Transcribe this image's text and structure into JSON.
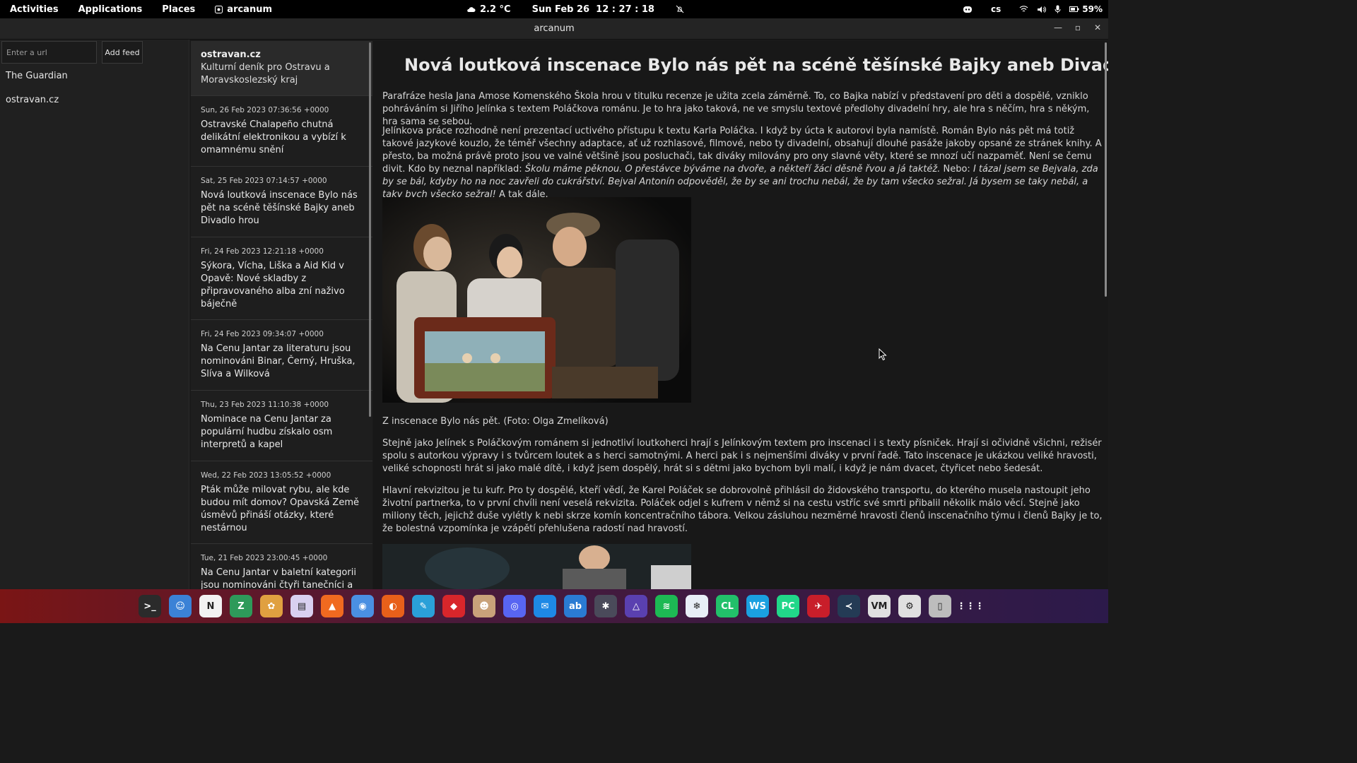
{
  "topbar": {
    "activities": "Activities",
    "applications": "Applications",
    "places": "Places",
    "app_name": "arcanum",
    "weather": "2.2 °C",
    "datetime": "Sun Feb 26  12 : 27 : 18",
    "lang": "cs",
    "battery": "59%"
  },
  "window": {
    "title": "arcanum"
  },
  "feeds": {
    "url_placeholder": "Enter a url",
    "add_label": "Add feed",
    "items": [
      {
        "label": "The Guardian"
      },
      {
        "label": "ostravan.cz"
      }
    ]
  },
  "articles": {
    "site": "ostravan.cz",
    "site_desc": "Kulturní deník pro Ostravu a Moravskoslezský kraj",
    "items": [
      {
        "date": "Sun, 26 Feb 2023 07:36:56 +0000",
        "title": "Ostravské Chalapeño chutná delikátní elektronikou a vybízí k omamnému snění"
      },
      {
        "date": "Sat, 25 Feb 2023 07:14:57 +0000",
        "title": "Nová loutková inscenace Bylo nás pět na scéně těšínské Bajky aneb Divadlo hrou"
      },
      {
        "date": "Fri, 24 Feb 2023 12:21:18 +0000",
        "title": "Sýkora, Vícha, Liška a Aid Kid v Opavě: Nové skladby z připravovaného alba zní naživo báječně"
      },
      {
        "date": "Fri, 24 Feb 2023 09:34:07 +0000",
        "title": "Na Cenu Jantar za literaturu jsou nominováni Binar, Černý, Hruška, Slíva a Wilková"
      },
      {
        "date": "Thu, 23 Feb 2023 11:10:38 +0000",
        "title": "Nominace na Cenu Jantar za populární hudbu získalo osm interpretů a kapel"
      },
      {
        "date": "Wed, 22 Feb 2023 13:05:52 +0000",
        "title": "Pták může milovat rybu, ale kde budou mít domov? Opavská Země úsměvů přináší otázky, které nestárnou"
      },
      {
        "date": "Tue, 21 Feb 2023 23:00:45 +0000",
        "title": "Na Cenu Jantar v baletní kategorii jsou nominováni čtyři tanečníci a"
      }
    ]
  },
  "reader": {
    "title": "Nová loutková inscenace Bylo nás pět na scéně těšínské Bajky aneb Divadlo hrou",
    "p1": "Parafráze hesla Jana Amose Komenského Škola hrou v titulku recenze je užita zcela záměrně. To, co Bajka nabízí v představení pro děti a dospělé, vzniklo pohráváním si Jiřího Jelínka s textem Poláčkova románu. Je to hra jako taková, ne ve smyslu textové předlohy divadelní hry, ale hra s něčím, hra s někým, hra sama se sebou.",
    "p2_a": "Jelínkova práce rozhodně není prezentací uctivého přístupu k textu Karla Poláčka. I když by úcta k autorovi byla namístě. Román Bylo nás pět má totiž takové jazykové kouzlo, že téměř všechny adaptace, ať už rozhlasové, filmové, nebo ty divadelní, obsahují dlouhé pasáže jakoby opsané ze stránek knihy. A přesto, ba možná právě proto jsou ve valné většině jsou posluchači, tak diváky milovány pro ony slavné věty, které se mnozí učí nazpaměť. Není se čemu divit. Kdo by neznal například: ",
    "p2_em1": "Školu máme pěknou. O přestávce býváme na dvoře, a někteří žáci děsně řvou a já taktéž.",
    "p2_b": " Nebo: ",
    "p2_em2": "I tázal jsem se Bejvala, zda by se bál, kdyby ho na noc zavřeli do cukrářství. Bejval Antonín odpověděl, že by se ani trochu nebál, že by tam všecko sežral. Já bysem se taky nebál, a taky bych všecko sežral!",
    "p2_c": " A tak dále.",
    "caption": "Z inscenace Bylo nás pět. (Foto: Olga Zmelíková)",
    "p3": "Stejně jako Jelínek s Poláčkovým románem si jednotliví loutkoherci hrají s Jelínkovým textem pro inscenaci i s texty písniček. Hrají si očividně všichni, režisér spolu s autorkou výpravy i s tvůrcem loutek a s herci samotnými. A herci pak i s nejmenšími diváky v první řadě. Tato inscenace je ukázkou veliké hravosti, veliké schopnosti hrát si jako malé dítě, i když jsem dospělý, hrát si s dětmi jako bychom byli malí, i když je nám dvacet, čtyřicet nebo šedesát.",
    "p4": "Hlavní rekvizitou je tu kufr. Pro ty dospělé, kteří vědí, že Karel Poláček se dobrovolně přihlásil do židovského transportu, do kterého musela nastoupit jeho životní partnerka, to v první chvíli není veselá rekvizita. Poláček odjel s kufrem v němž si na cestu vstříc své smrti přibalil několik málo věcí. Stejně jako miliony těch, jejichž duše vylétly k nebi skrze komín koncentračního tábora. Velkou zásluhou nezměrné hravosti členů inscenačního týmu i členů Bajky je to, že bolestná vzpomínka je vzápětí přehlušena radostí nad hravostí."
  },
  "dock": {
    "apps": [
      {
        "name": "terminal-icon",
        "color": "#2b2b2b",
        "glyph": ">_"
      },
      {
        "name": "files-icon",
        "color": "#3b82d6",
        "glyph": "☺"
      },
      {
        "name": "notion-icon",
        "color": "#f2f2f2",
        "glyph": "N"
      },
      {
        "name": "zeal-icon",
        "color": "#2e9a5a",
        "glyph": "Z"
      },
      {
        "name": "photos-icon",
        "color": "#e0a040",
        "glyph": "✿"
      },
      {
        "name": "document-icon",
        "color": "#d9d0f0",
        "glyph": "▤"
      },
      {
        "name": "brave-icon",
        "color": "#f06a20",
        "glyph": "▲"
      },
      {
        "name": "chromium-icon",
        "color": "#4a90e2",
        "glyph": "◉"
      },
      {
        "name": "firefox-icon",
        "color": "#e8601a",
        "glyph": "◐"
      },
      {
        "name": "feather-icon",
        "color": "#2aa0d8",
        "glyph": "✎"
      },
      {
        "name": "anydesk-icon",
        "color": "#d8262b",
        "glyph": "◆"
      },
      {
        "name": "avatar-app-icon",
        "color": "#c9a27a",
        "glyph": "☻"
      },
      {
        "name": "discord-icon",
        "color": "#5865f2",
        "glyph": "◎"
      },
      {
        "name": "chat-icon",
        "color": "#1e88e5",
        "glyph": "✉"
      },
      {
        "name": "appstore-icon",
        "color": "#2a7bd3",
        "glyph": "ab"
      },
      {
        "name": "settings-icon",
        "color": "#4a4a5a",
        "glyph": "✱"
      },
      {
        "name": "prism-icon",
        "color": "#5a40b0",
        "glyph": "△"
      },
      {
        "name": "spotify-icon",
        "color": "#1db954",
        "glyph": "≋"
      },
      {
        "name": "flatseal-icon",
        "color": "#e8eef6",
        "glyph": "❄"
      },
      {
        "name": "clion-icon",
        "color": "#22c06a",
        "glyph": "CL"
      },
      {
        "name": "webstorm-icon",
        "color": "#1aa0e0",
        "glyph": "WS"
      },
      {
        "name": "pycharm-icon",
        "color": "#21d789",
        "glyph": "PC"
      },
      {
        "name": "shutter-icon",
        "color": "#c81e2a",
        "glyph": "✈"
      },
      {
        "name": "vscode-icon",
        "color": "#243b55",
        "glyph": "≺"
      },
      {
        "name": "vim-icon",
        "color": "#e0e0e0",
        "glyph": "VM"
      },
      {
        "name": "text-editor-icon",
        "color": "#e0e0e0",
        "glyph": "⚙"
      },
      {
        "name": "trash-icon",
        "color": "#bdbdbd",
        "glyph": "▯"
      },
      {
        "name": "app-grid-icon",
        "color": "transparent",
        "glyph": "⋮⋮⋮"
      }
    ]
  }
}
